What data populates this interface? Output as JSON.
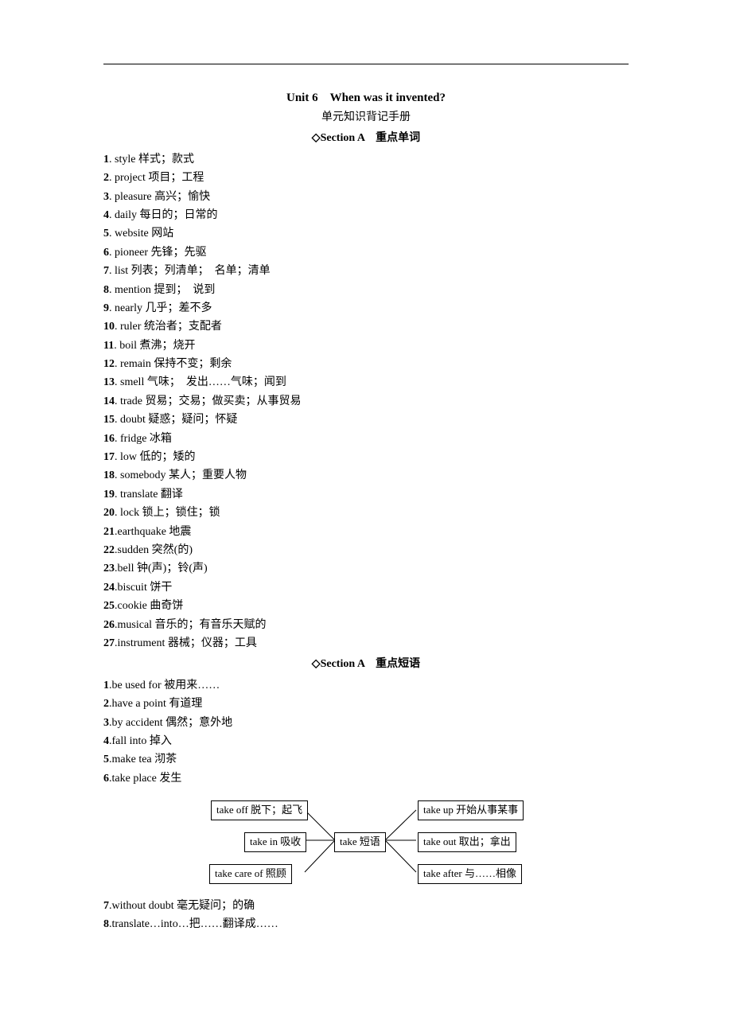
{
  "title": "Unit 6　When was it invented?",
  "subtitle": "单元知识背记手册",
  "sectionA_words_header": "◇Section A　重点单词",
  "sectionA_words": [
    {
      "n": "1",
      "t": ". style 样式；款式"
    },
    {
      "n": "2",
      "t": ". project 项目；工程"
    },
    {
      "n": "3",
      "t": ". pleasure 高兴；愉快"
    },
    {
      "n": "4",
      "t": ". daily 每日的；日常的"
    },
    {
      "n": "5",
      "t": ". website 网站"
    },
    {
      "n": "6",
      "t": ". pioneer 先锋；先驱"
    },
    {
      "n": "7",
      "t": ". list 列表；列清单；　名单；清单"
    },
    {
      "n": "8",
      "t": ". mention 提到；　说到"
    },
    {
      "n": "9",
      "t": ". nearly 几乎；差不多"
    },
    {
      "n": "10",
      "t": ". ruler 统治者；支配者"
    },
    {
      "n": "11",
      "t": ". boil 煮沸；烧开"
    },
    {
      "n": "12",
      "t": ". remain 保持不变；剩余"
    },
    {
      "n": "13",
      "t": ". smell 气味；　发出……气味；闻到"
    },
    {
      "n": "14",
      "t": ". trade 贸易；交易；做买卖；从事贸易"
    },
    {
      "n": "15",
      "t": ". doubt 疑惑；疑问；怀疑"
    },
    {
      "n": "16",
      "t": ". fridge 冰箱"
    },
    {
      "n": "17",
      "t": ". low 低的；矮的"
    },
    {
      "n": "18",
      "t": ". somebody 某人；重要人物"
    },
    {
      "n": "19",
      "t": ". translate 翻译"
    },
    {
      "n": "20",
      "t": ". lock 锁上；锁住；锁"
    },
    {
      "n": "21",
      "t": ".earthquake 地震"
    },
    {
      "n": "22",
      "t": ".sudden 突然(的)"
    },
    {
      "n": "23",
      "t": ".bell 钟(声)；铃(声)"
    },
    {
      "n": "24",
      "t": ".biscuit 饼干"
    },
    {
      "n": "25",
      "t": ".cookie 曲奇饼"
    },
    {
      "n": "26",
      "t": ".musical 音乐的；有音乐天赋的"
    },
    {
      "n": "27",
      "t": ".instrument 器械；仪器；工具"
    }
  ],
  "sectionA_phrases_header": "◇Section A　重点短语",
  "sectionA_phrases_top": [
    {
      "n": "1",
      "t": ".be used for 被用来……"
    },
    {
      "n": "2",
      "t": ".have a point 有道理"
    },
    {
      "n": "3",
      "t": ".by accident 偶然；意外地"
    },
    {
      "n": "4",
      "t": ".fall into 掉入"
    },
    {
      "n": "5",
      "t": ".make tea 沏茶"
    },
    {
      "n": "6",
      "t": ".take place 发生"
    }
  ],
  "diagram": {
    "center": "take 短语",
    "tl": "take off 脱下；起飞",
    "ml": "take in 吸收",
    "bl": "take care of 照顾",
    "tr": "take up 开始从事某事",
    "mr": "take out 取出；拿出",
    "br": "take after 与……相像"
  },
  "sectionA_phrases_bottom": [
    {
      "n": "7",
      "t": ".without doubt 毫无疑问；的确"
    },
    {
      "n": "8",
      "t": ".translate…into…把……翻译成……"
    }
  ]
}
